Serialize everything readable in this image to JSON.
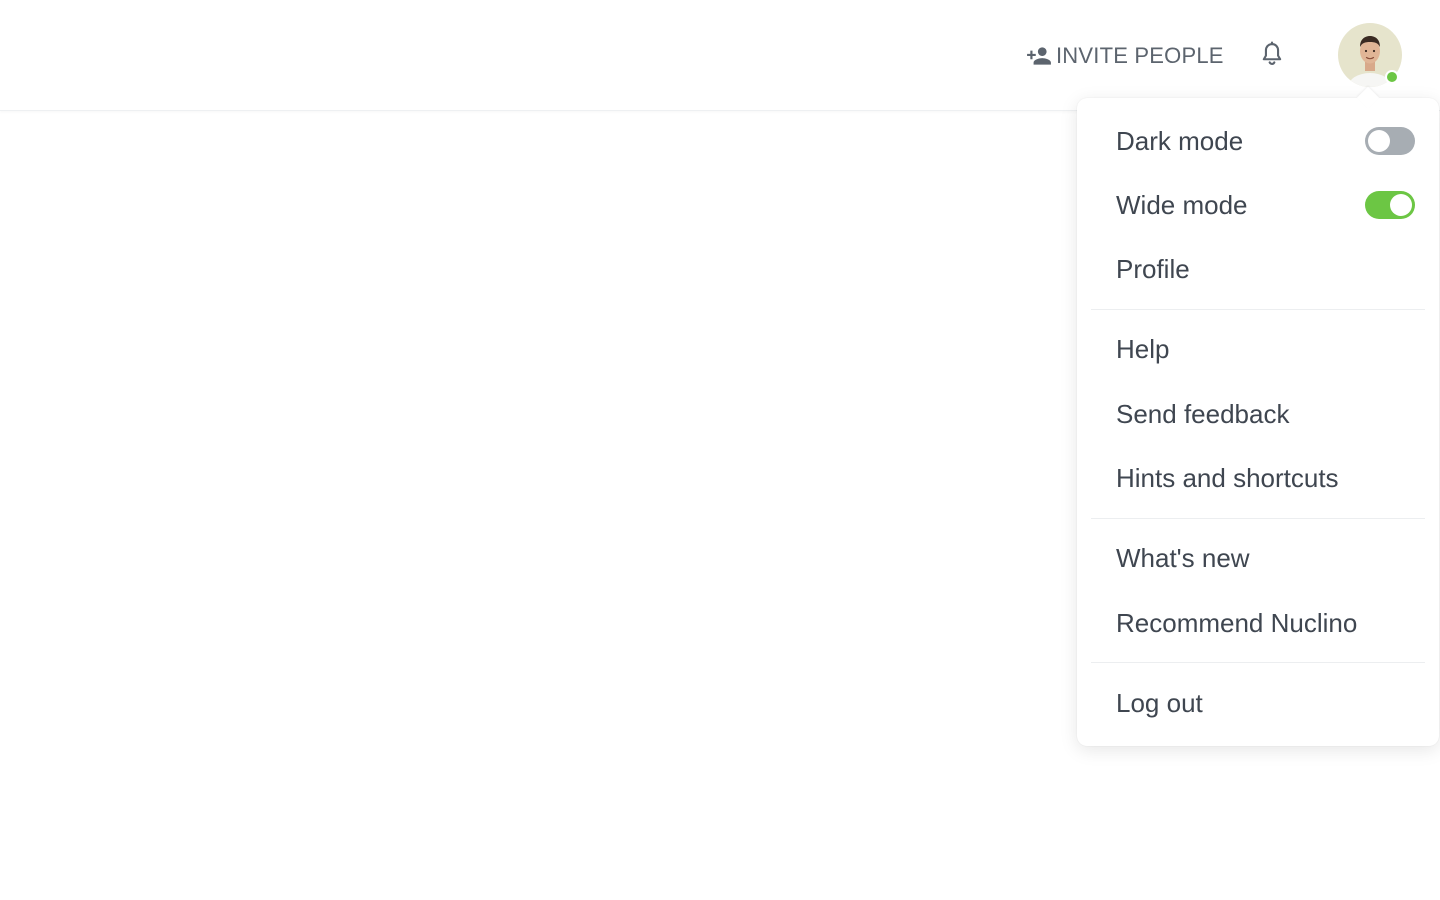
{
  "header": {
    "invite_label": "INVITE PEOPLE",
    "invite_icon": "add-person-icon",
    "notifications_icon": "bell-icon",
    "avatar_status": "online"
  },
  "menu": {
    "dark_mode": {
      "label": "Dark mode",
      "enabled": false
    },
    "wide_mode": {
      "label": "Wide mode",
      "enabled": true
    },
    "profile": "Profile",
    "help": "Help",
    "send_feedback": "Send feedback",
    "hints_shortcuts": "Hints and shortcuts",
    "whats_new": "What's new",
    "recommend": "Recommend Nuclino",
    "logout": "Log out"
  },
  "colors": {
    "toggle_on": "#6cc644",
    "toggle_off": "#a7adb3",
    "presence_online": "#6cc644",
    "text": "#3f4650"
  }
}
